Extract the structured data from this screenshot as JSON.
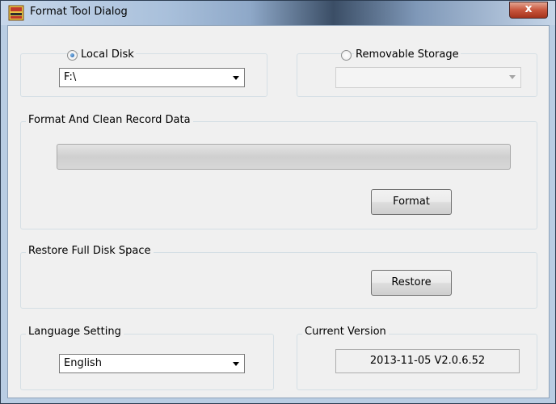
{
  "window": {
    "title": "Format Tool Dialog",
    "close_glyph": "x"
  },
  "disk_selection": {
    "local_disk": {
      "label": "Local Disk",
      "selected": true,
      "drive_value": "F:\\"
    },
    "removable_storage": {
      "label": "Removable Storage",
      "selected": false,
      "drive_value": ""
    }
  },
  "format_section": {
    "title": "Format And Clean Record Data",
    "progress": 0,
    "button_label": "Format"
  },
  "restore_section": {
    "title": "Restore Full Disk Space",
    "button_label": "Restore"
  },
  "language_section": {
    "title": "Language Setting",
    "selected": "English"
  },
  "version_section": {
    "title": "Current Version",
    "value": "2013-11-05 V2.0.6.52"
  },
  "colors": {
    "accent_radio": "#1e5ea8",
    "close_button": "#c8553c"
  },
  "icons": {
    "app": "app-icon"
  }
}
